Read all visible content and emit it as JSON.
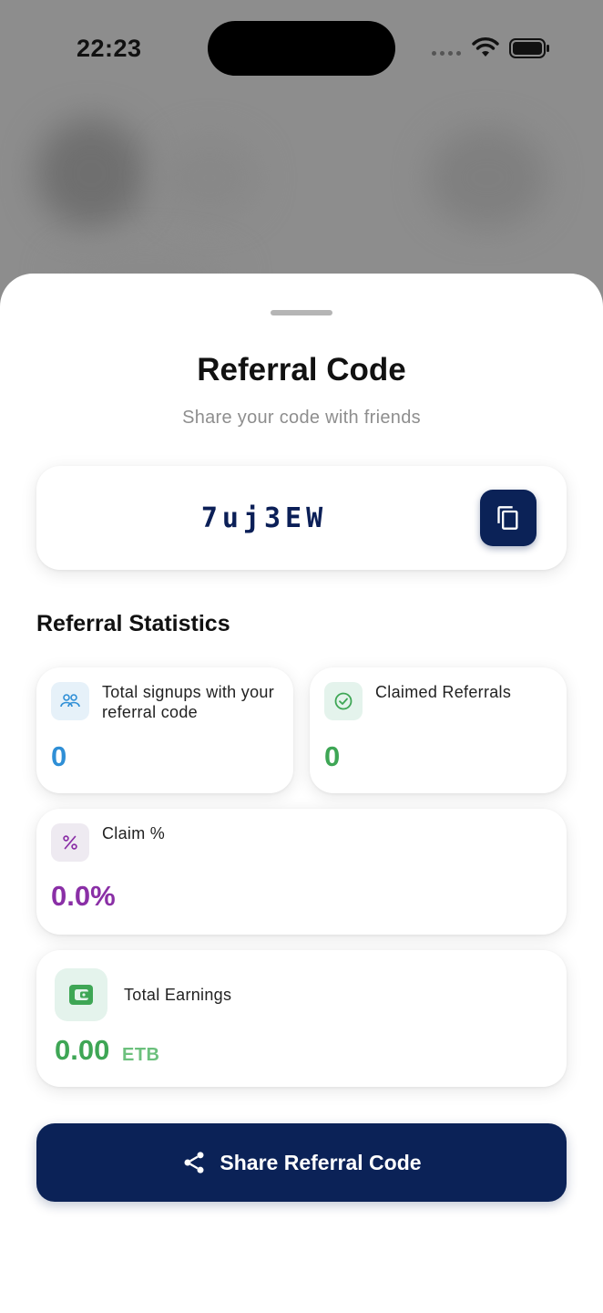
{
  "status_bar": {
    "time": "22:23"
  },
  "sheet": {
    "title": "Referral Code",
    "subtitle": "Share your code with friends"
  },
  "referral": {
    "code": "7uj3EW",
    "copy_icon": "copy-icon"
  },
  "stats": {
    "heading": "Referral Statistics",
    "signups": {
      "label": "Total signups with your referral code",
      "value": "0",
      "icon": "users-icon",
      "color": "#2f8fd6"
    },
    "claimed": {
      "label": "Claimed Referrals",
      "value": "0",
      "icon": "check-circle-icon",
      "color": "#3ea655"
    },
    "claim_percent": {
      "label": "Claim %",
      "value": "0.0%",
      "icon": "percent-icon",
      "color": "#8a2fa6"
    },
    "earnings": {
      "label": "Total Earnings",
      "value": "0.00",
      "unit": "ETB",
      "icon": "wallet-icon",
      "color": "#3ea655"
    }
  },
  "share_button": {
    "label": "Share Referral Code",
    "icon": "share-icon"
  },
  "colors": {
    "primary": "#0b2257",
    "accent_blue": "#2f8fd6",
    "accent_green": "#3ea655",
    "accent_purple": "#8a2fa6"
  }
}
